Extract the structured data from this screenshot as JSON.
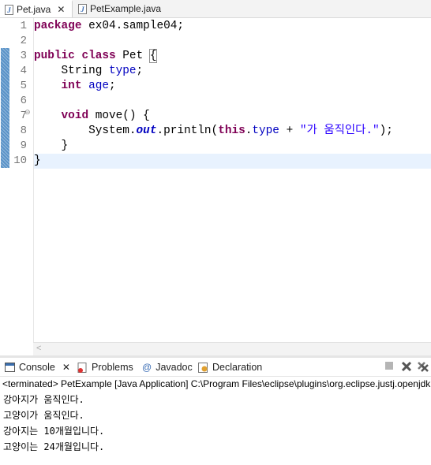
{
  "editor_tabs": [
    {
      "label": "Pet.java",
      "active": true
    },
    {
      "label": "PetExample.java",
      "active": false
    }
  ],
  "code_lines": [
    {
      "num": "1",
      "tokens": [
        {
          "t": "package",
          "c": "kw"
        },
        {
          "t": " ex04.sample04;",
          "c": ""
        }
      ]
    },
    {
      "num": "2",
      "tokens": []
    },
    {
      "num": "3",
      "tokens": [
        {
          "t": "public",
          "c": "kw"
        },
        {
          "t": " ",
          "c": ""
        },
        {
          "t": "class",
          "c": "kw"
        },
        {
          "t": " Pet ",
          "c": ""
        },
        {
          "t": "{",
          "c": "brace-box"
        }
      ]
    },
    {
      "num": "4",
      "tokens": [
        {
          "t": "    String ",
          "c": ""
        },
        {
          "t": "type",
          "c": "fld"
        },
        {
          "t": ";",
          "c": ""
        }
      ]
    },
    {
      "num": "5",
      "tokens": [
        {
          "t": "    ",
          "c": ""
        },
        {
          "t": "int",
          "c": "kw"
        },
        {
          "t": " ",
          "c": ""
        },
        {
          "t": "age",
          "c": "fld"
        },
        {
          "t": ";",
          "c": ""
        }
      ]
    },
    {
      "num": "6",
      "tokens": []
    },
    {
      "num": "7",
      "tokens": [
        {
          "t": "    ",
          "c": ""
        },
        {
          "t": "void",
          "c": "kw"
        },
        {
          "t": " move() {",
          "c": ""
        }
      ]
    },
    {
      "num": "8",
      "tokens": [
        {
          "t": "        System.",
          "c": ""
        },
        {
          "t": "out",
          "c": "sfld"
        },
        {
          "t": ".println(",
          "c": ""
        },
        {
          "t": "this",
          "c": "kw"
        },
        {
          "t": ".",
          "c": ""
        },
        {
          "t": "type",
          "c": "fld"
        },
        {
          "t": " + ",
          "c": ""
        },
        {
          "t": "\"가 움직인다.\"",
          "c": "str"
        },
        {
          "t": ");",
          "c": ""
        }
      ]
    },
    {
      "num": "9",
      "tokens": [
        {
          "t": "    }",
          "c": ""
        }
      ]
    },
    {
      "num": "10",
      "tokens": [
        {
          "t": "}",
          "c": ""
        }
      ]
    }
  ],
  "console_tabs": [
    {
      "label": "Console",
      "icon": "console-icon"
    },
    {
      "label": "Problems",
      "icon": "problems-icon"
    },
    {
      "label": "Javadoc",
      "icon": "at-icon"
    },
    {
      "label": "Declaration",
      "icon": "declaration-icon"
    }
  ],
  "console": {
    "status": "<terminated> PetExample [Java Application] C:\\Program Files\\eclipse\\plugins\\org.eclipse.justj.openjdk",
    "output": [
      "강아지가 움직인다.",
      "고양이가 움직인다.",
      "강아지는 10개월입니다.",
      "고양이는 24개월입니다."
    ]
  },
  "colors": {
    "keyword": "#7f0055",
    "field": "#0000c0",
    "string": "#2a00ff",
    "current_line": "#e8f2fe",
    "change_bar": "#5a93c8"
  }
}
